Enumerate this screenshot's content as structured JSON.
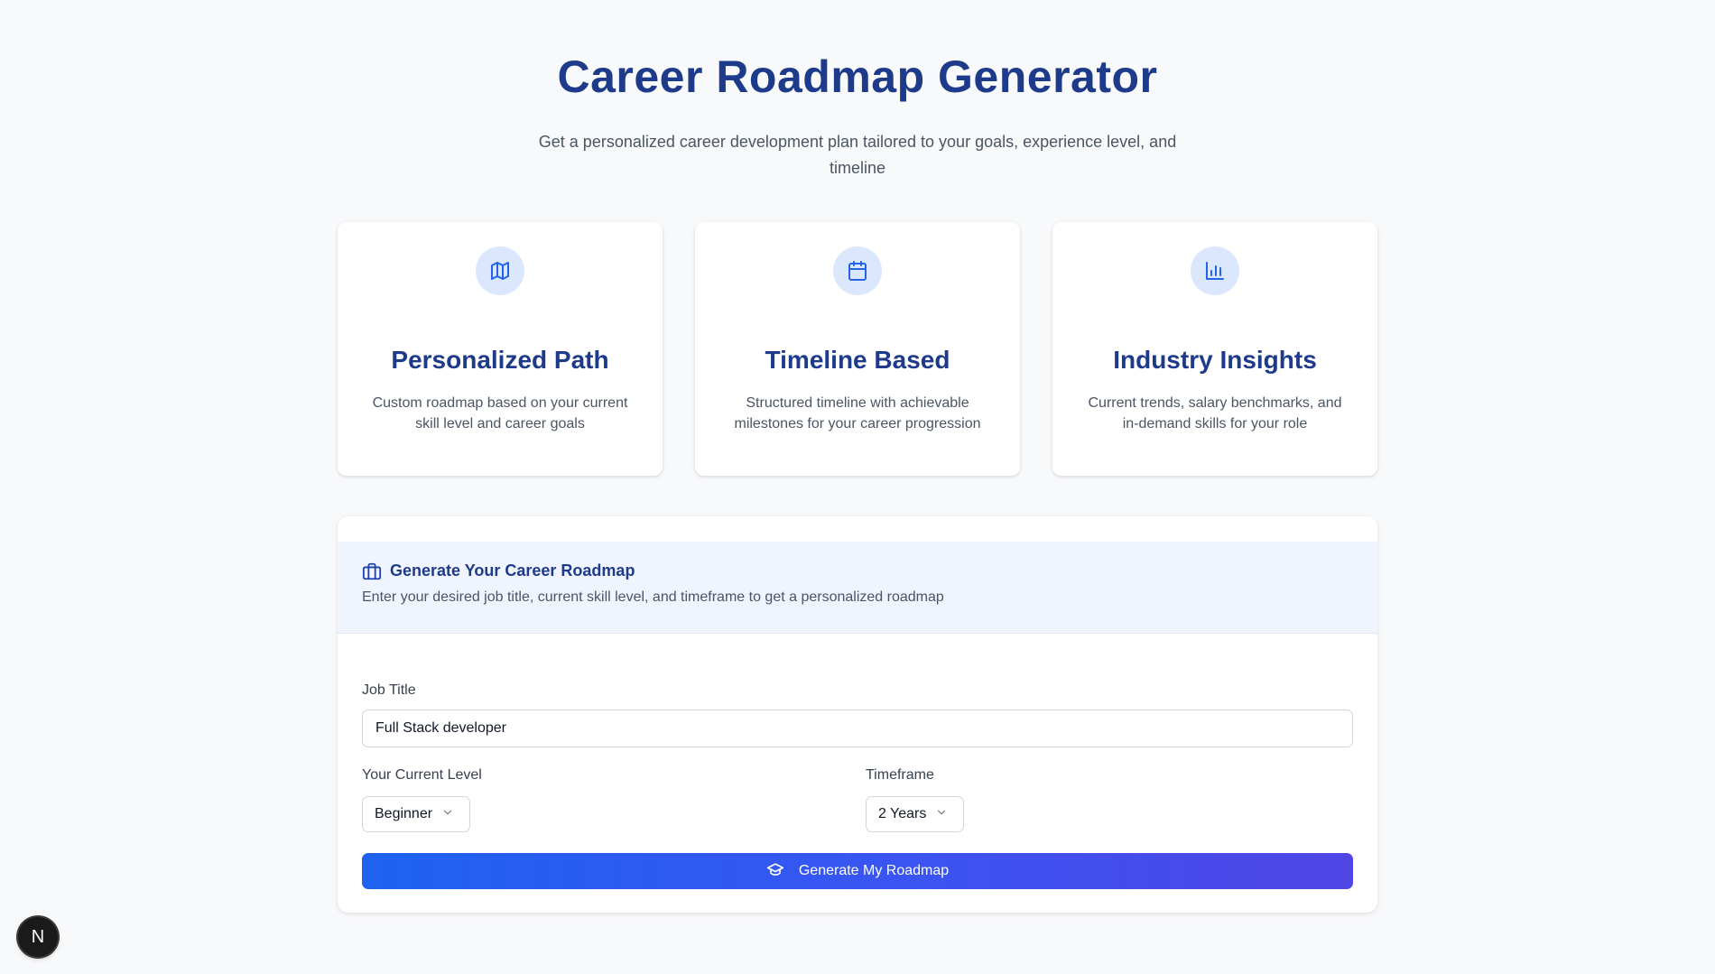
{
  "header": {
    "title": "Career Roadmap Generator",
    "subtitle": "Get a personalized career development plan tailored to your goals, experience level, and timeline"
  },
  "features": [
    {
      "icon": "map-icon",
      "title": "Personalized Path",
      "description": "Custom roadmap based on your current skill level and career goals"
    },
    {
      "icon": "calendar-icon",
      "title": "Timeline Based",
      "description": "Structured timeline with achievable milestones for your career progression"
    },
    {
      "icon": "bar-chart-icon",
      "title": "Industry Insights",
      "description": "Current trends, salary benchmarks, and in-demand skills for your role"
    }
  ],
  "form": {
    "icon": "briefcase-icon",
    "title": "Generate Your Career Roadmap",
    "description": "Enter your desired job title, current skill level, and timeframe to get a personalized roadmap",
    "job_title_label": "Job Title",
    "job_title_value": "Full Stack developer",
    "level_label": "Your Current Level",
    "level_value": "Beginner",
    "timeframe_label": "Timeframe",
    "timeframe_value": "2 Years",
    "submit_label": "Generate My Roadmap",
    "submit_icon": "graduation-cap-icon"
  },
  "badge": {
    "letter": "N"
  },
  "colors": {
    "accent": "#1e3a8a",
    "icon_bg": "#dbe7fd",
    "button_start": "#1d62f0",
    "button_end": "#4f46e5",
    "page_bg": "#f8f9fb"
  }
}
